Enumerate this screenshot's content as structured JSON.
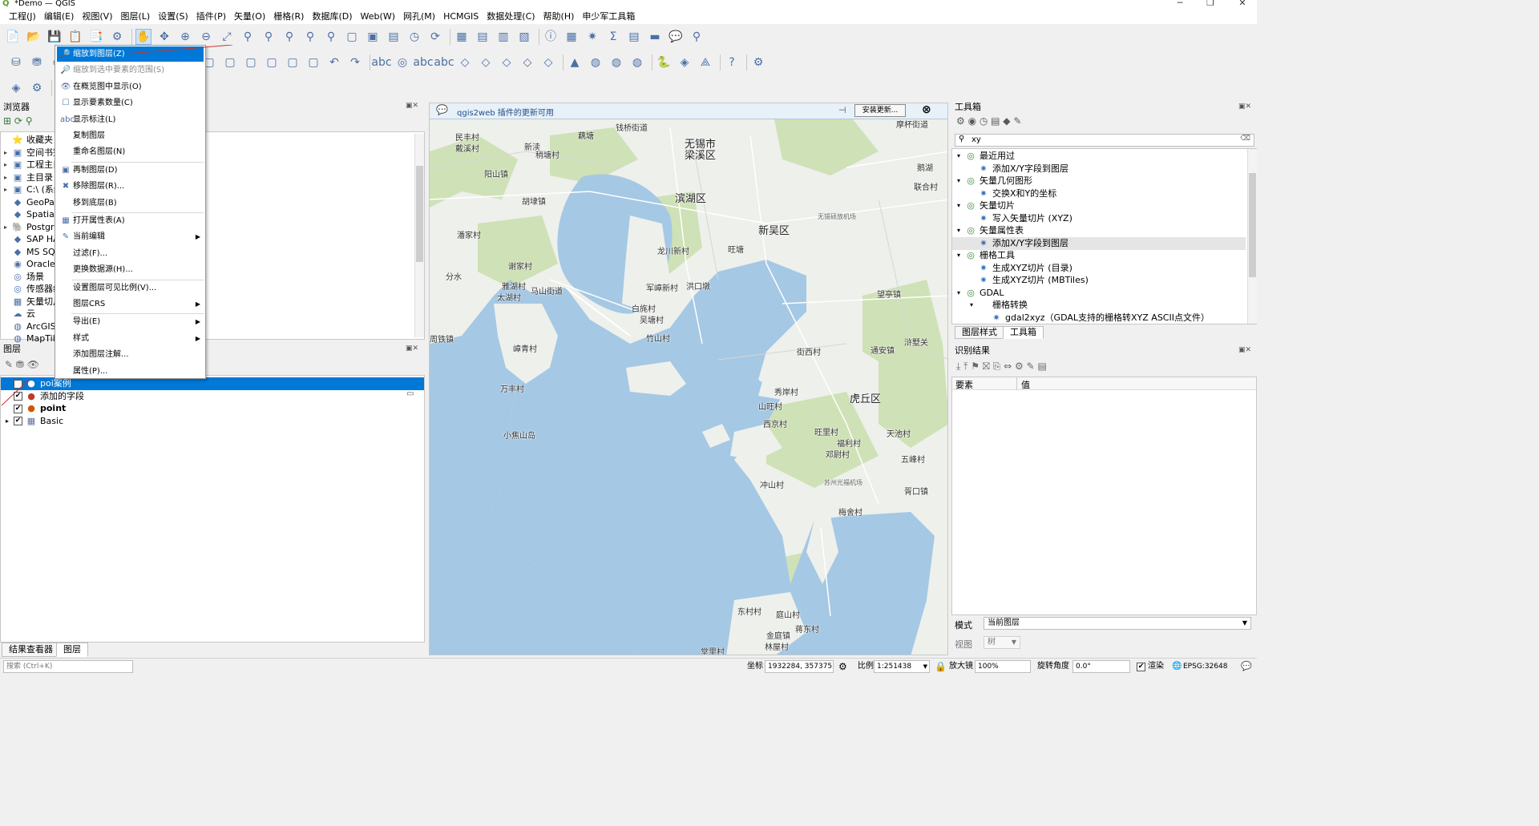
{
  "window": {
    "title": "*Demo — QGIS",
    "app_glyph": "Q"
  },
  "menubar": [
    "工程(J)",
    "编辑(E)",
    "视图(V)",
    "图层(L)",
    "设置(S)",
    "插件(P)",
    "矢量(O)",
    "栅格(R)",
    "数据库(D)",
    "Web(W)",
    "网孔(M)",
    "HCMGIS",
    "数据处理(C)",
    "帮助(H)",
    "申少军工具箱"
  ],
  "browser": {
    "title": "浏览器",
    "items": [
      "收藏夹",
      "空间书签",
      "工程主目录",
      "主目录",
      "C:\\ (系统)",
      "GeoPackage",
      "SpatiaLite",
      "PostgreSQL",
      "SAP HANA",
      "MS SQL Server",
      "Oracle",
      "场景",
      "传感器组",
      "矢量切片",
      "云",
      "ArcGIS",
      "MapTiler"
    ]
  },
  "layers": {
    "title": "图层",
    "rows": [
      {
        "label": "poi案例",
        "selected": true,
        "checked": true
      },
      {
        "label": "添加的字段",
        "selected": false,
        "checked": true
      },
      {
        "label": "point",
        "selected": false,
        "checked": true
      },
      {
        "label": "Basic",
        "selected": false,
        "checked": true
      }
    ]
  },
  "context_menu": [
    {
      "label": "缩放到图层(Z)",
      "state": "highlight",
      "icon": "🔎"
    },
    {
      "label": "缩放到选中要素的范围(S)",
      "state": "disabled",
      "icon": "🔎"
    },
    {
      "label": "在概览图中显示(O)",
      "state": "normal",
      "icon": "👁"
    },
    {
      "label": "显示要素数量(C)",
      "state": "normal",
      "icon": "☐"
    },
    {
      "label": "显示标注(L)",
      "state": "normal",
      "icon": "abc"
    },
    {
      "label": "复制图层",
      "state": "normal",
      "icon": ""
    },
    {
      "label": "重命名图层(N)",
      "state": "normal",
      "icon": ""
    },
    {
      "label": "再制图层(D)",
      "state": "normal",
      "icon": "▣"
    },
    {
      "label": "移除图层(R)...",
      "state": "normal",
      "icon": "✖"
    },
    {
      "label": "移到底层(B)",
      "state": "normal",
      "icon": ""
    },
    {
      "label": "打开属性表(A)",
      "state": "normal",
      "icon": "▦"
    },
    {
      "label": "当前编辑",
      "state": "normal",
      "icon": "✎",
      "submenu": true
    },
    {
      "label": "过滤(F)...",
      "state": "normal",
      "icon": ""
    },
    {
      "label": "更换数据源(H)...",
      "state": "normal",
      "icon": ""
    },
    {
      "label": "设置图层可见比例(V)...",
      "state": "normal",
      "icon": ""
    },
    {
      "label": "图层CRS",
      "state": "normal",
      "icon": "",
      "submenu": true
    },
    {
      "label": "导出(E)",
      "state": "normal",
      "icon": "",
      "submenu": true
    },
    {
      "label": "样式",
      "state": "normal",
      "icon": "",
      "submenu": true
    },
    {
      "label": "添加图层注解...",
      "state": "normal",
      "icon": ""
    },
    {
      "label": "属性(P)...",
      "state": "normal",
      "icon": ""
    }
  ],
  "map": {
    "notification": "qgis2web 插件的更新可用",
    "install_button": "安装更新...",
    "labels": [
      {
        "t": "无锡市",
        "cls": "big"
      },
      {
        "t": "梁溪区",
        "cls": "big"
      },
      {
        "t": "滨湖区",
        "cls": "big"
      },
      {
        "t": "新吴区",
        "cls": "big"
      },
      {
        "t": "虎丘区",
        "cls": "big"
      },
      {
        "t": "钱桥街道",
        "cls": ""
      },
      {
        "t": "藕塘",
        "cls": ""
      },
      {
        "t": "民丰村",
        "cls": ""
      },
      {
        "t": "戴溪村",
        "cls": ""
      },
      {
        "t": "新渎",
        "cls": ""
      },
      {
        "t": "稍塘村",
        "cls": ""
      },
      {
        "t": "阳山镇",
        "cls": ""
      },
      {
        "t": "胡埭镇",
        "cls": ""
      },
      {
        "t": "潘家村",
        "cls": ""
      },
      {
        "t": "谢家村",
        "cls": ""
      },
      {
        "t": "分水",
        "cls": ""
      },
      {
        "t": "雅湖村",
        "cls": ""
      },
      {
        "t": "太湖村",
        "cls": ""
      },
      {
        "t": "马山街道",
        "cls": ""
      },
      {
        "t": "龙川新村",
        "cls": ""
      },
      {
        "t": "军嶂新村",
        "cls": ""
      },
      {
        "t": "洪口墩",
        "cls": ""
      },
      {
        "t": "白旄村",
        "cls": ""
      },
      {
        "t": "吴塘村",
        "cls": ""
      },
      {
        "t": "竹山村",
        "cls": ""
      },
      {
        "t": "嶂青村",
        "cls": ""
      },
      {
        "t": "万丰村",
        "cls": ""
      },
      {
        "t": "小焦山岛",
        "cls": ""
      },
      {
        "t": "周铁镇",
        "cls": ""
      },
      {
        "t": "街西村",
        "cls": ""
      },
      {
        "t": "通安镇",
        "cls": ""
      },
      {
        "t": "秀岸村",
        "cls": ""
      },
      {
        "t": "山旺村",
        "cls": ""
      },
      {
        "t": "西京村",
        "cls": ""
      },
      {
        "t": "天池村",
        "cls": ""
      },
      {
        "t": "旺里村",
        "cls": ""
      },
      {
        "t": "福利村",
        "cls": ""
      },
      {
        "t": "邓尉村",
        "cls": ""
      },
      {
        "t": "五峰村",
        "cls": ""
      },
      {
        "t": "冲山村",
        "cls": ""
      },
      {
        "t": "胥口镇",
        "cls": ""
      },
      {
        "t": "梅舍村",
        "cls": ""
      },
      {
        "t": "东村村",
        "cls": ""
      },
      {
        "t": "庭山村",
        "cls": ""
      },
      {
        "t": "蒋东村",
        "cls": ""
      },
      {
        "t": "金庭镇",
        "cls": ""
      },
      {
        "t": "林屋村",
        "cls": ""
      },
      {
        "t": "堂里村",
        "cls": ""
      },
      {
        "t": "望亭镇",
        "cls": ""
      },
      {
        "t": "联合村",
        "cls": ""
      },
      {
        "t": "鹅湖",
        "cls": ""
      },
      {
        "t": "浒墅关",
        "cls": ""
      },
      {
        "t": "摩杯街道",
        "cls": ""
      },
      {
        "t": "旺塘",
        "cls": ""
      },
      {
        "t": "无锡硕放机场",
        "cls": "small"
      },
      {
        "t": "苏州光福机场",
        "cls": "small"
      }
    ]
  },
  "toolbox": {
    "title": "工具箱",
    "search_value": "xy",
    "items": [
      {
        "label": "最近用过",
        "level": 0
      },
      {
        "label": "添加X/Y字段到图层",
        "level": 1
      },
      {
        "label": "矢量几何图形",
        "level": 0
      },
      {
        "label": "交换X和Y的坐标",
        "level": 1
      },
      {
        "label": "矢量切片",
        "level": 0
      },
      {
        "label": "写入矢量切片 (XYZ)",
        "level": 1
      },
      {
        "label": "矢量属性表",
        "level": 0
      },
      {
        "label": "添加X/Y字段到图层",
        "level": 1,
        "selected": true
      },
      {
        "label": "栅格工具",
        "level": 0
      },
      {
        "label": "生成XYZ切片 (目录)",
        "level": 1
      },
      {
        "label": "生成XYZ切片 (MBTiles)",
        "level": 1
      },
      {
        "label": "GDAL",
        "level": 0
      },
      {
        "label": "栅格转换",
        "level": 1
      },
      {
        "label": "gdal2xyz（GDAL支持的栅格转XYZ ASCII点文件）",
        "level": 2
      }
    ],
    "tabs": [
      "图层样式",
      "工具箱"
    ]
  },
  "identify": {
    "title": "识别结果",
    "col_feature": "要素",
    "col_value": "值",
    "mode_label": "模式",
    "mode_value": "当前图层",
    "view_label": "视图",
    "view_value": "树"
  },
  "bottom_tabs": [
    "结果查看器",
    "图层"
  ],
  "status": {
    "search_placeholder": "搜索 (Ctrl+K)",
    "coord_label": "坐标",
    "coord_value": "1932284, 3573751",
    "scale_label": "比例",
    "scale_value": "1:251438",
    "magnifier_label": "放大镜",
    "magnifier_value": "100%",
    "rotation_label": "旋转角度",
    "rotation_value": "0.0°",
    "render_label": "渲染",
    "crs_value": "EPSG:32648"
  },
  "colors": {
    "water": "#a5c8e4",
    "land": "#eef0ec",
    "green": "#cfe1b6",
    "highlight": "#0078d7"
  }
}
